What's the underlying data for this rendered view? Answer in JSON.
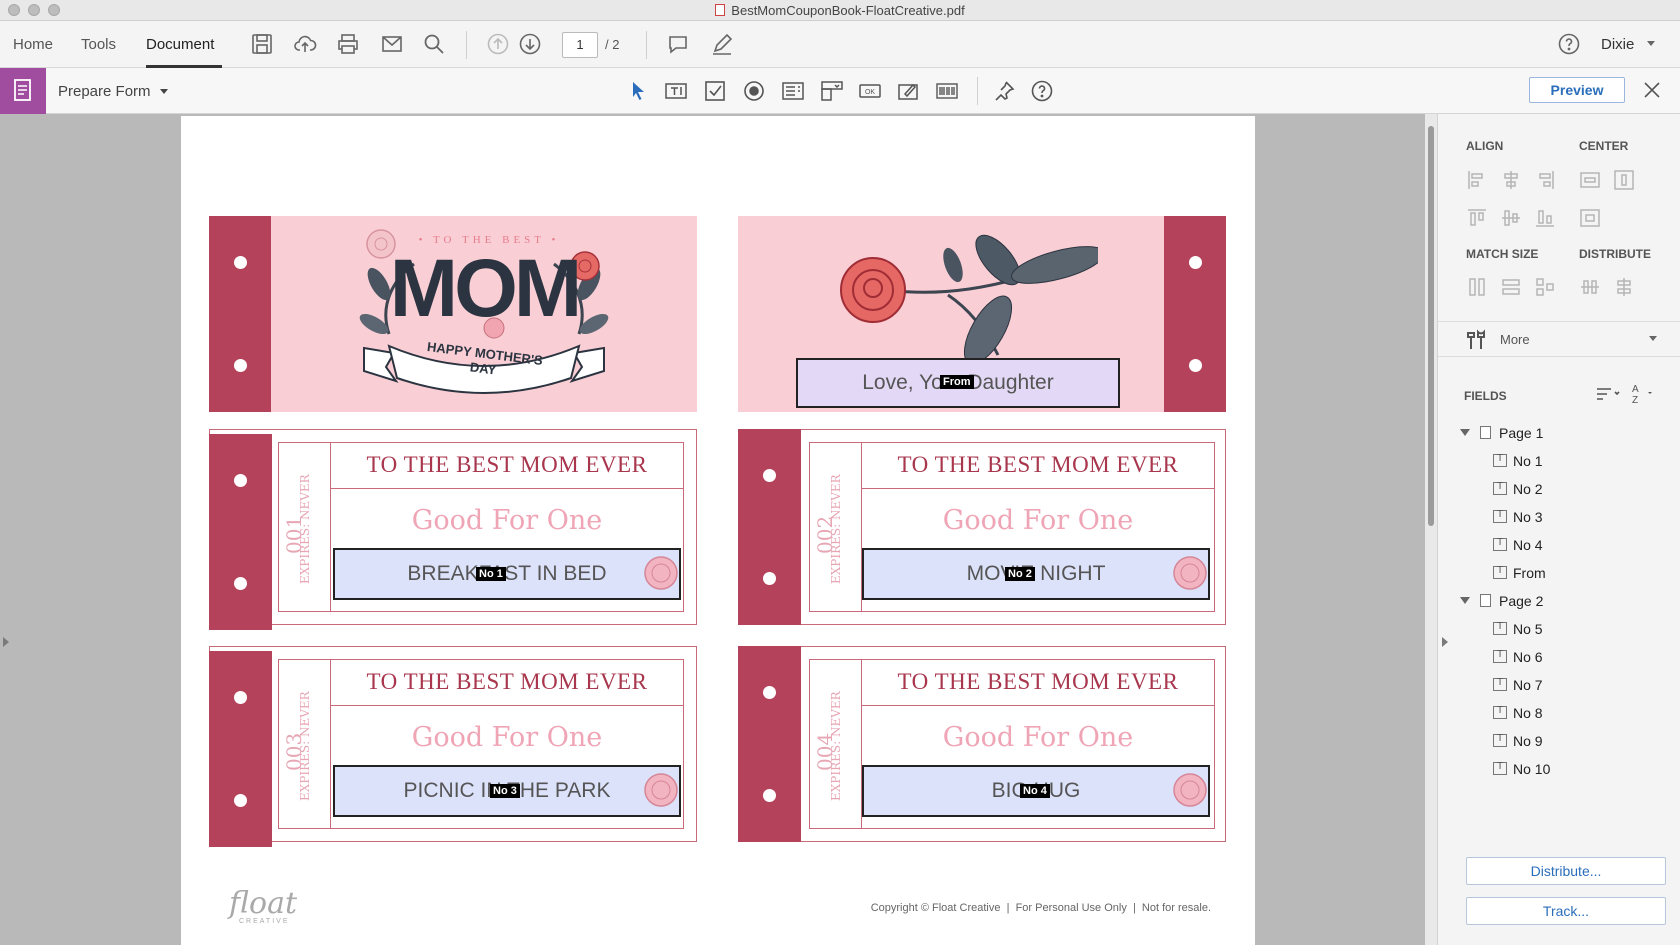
{
  "window": {
    "title": "BestMomCouponBook-FloatCreative.pdf"
  },
  "toolbar": {
    "tabs": [
      "Home",
      "Tools",
      "Document"
    ],
    "page_current": "1",
    "page_total": "/ 2",
    "user": "Dixie"
  },
  "formbar": {
    "title": "Prepare Form",
    "preview_label": "Preview"
  },
  "document": {
    "hero": {
      "kicker": "• TO THE BEST •",
      "mom": "MOM",
      "banner": "HAPPY MOTHER'S DAY"
    },
    "from_field": {
      "value": "Love, Your Daughter",
      "tag": "From"
    },
    "coupons": [
      {
        "number": "001",
        "expires": "EXPIRES: NEVER",
        "heading": "TO THE BEST MOM EVER",
        "subtitle": "Good For One",
        "value": "BREAKFAST IN BED",
        "tag": "No 1"
      },
      {
        "number": "002",
        "expires": "EXPIRES: NEVER",
        "heading": "TO THE BEST MOM EVER",
        "subtitle": "Good For One",
        "value": "MOVIE NIGHT",
        "tag": "No 2"
      },
      {
        "number": "003",
        "expires": "EXPIRES: NEVER",
        "heading": "TO THE BEST MOM EVER",
        "subtitle": "Good For One",
        "value": "PICNIC IN THE PARK",
        "tag": "No 3"
      },
      {
        "number": "004",
        "expires": "EXPIRES: NEVER",
        "heading": "TO THE BEST MOM EVER",
        "subtitle": "Good For One",
        "value": "BIG HUG",
        "tag": "No 4"
      }
    ],
    "footer": {
      "logo": "float",
      "logo_sub": "CREATIVE",
      "copyright": "Copyright © Float Creative  |  For Personal Use Only  |  Not for resale."
    }
  },
  "rightpanel": {
    "align": "ALIGN",
    "center": "CENTER",
    "match_size": "MATCH SIZE",
    "distribute": "DISTRIBUTE",
    "more": "More",
    "fields": "FIELDS",
    "tree": [
      {
        "page": "Page 1",
        "items": [
          "No 1",
          "No 2",
          "No 3",
          "No 4",
          "From"
        ]
      },
      {
        "page": "Page 2",
        "items": [
          "No 5",
          "No 6",
          "No 7",
          "No 8",
          "No 9",
          "No 10"
        ]
      }
    ],
    "distribute_btn": "Distribute...",
    "track_btn": "Track..."
  },
  "colors": {
    "accent": "#b4425a",
    "pink_bg": "#f9cfd5",
    "field_bg": "#dde2fb",
    "link_blue": "#2a6ebb",
    "form_purple": "#a04c9f"
  }
}
